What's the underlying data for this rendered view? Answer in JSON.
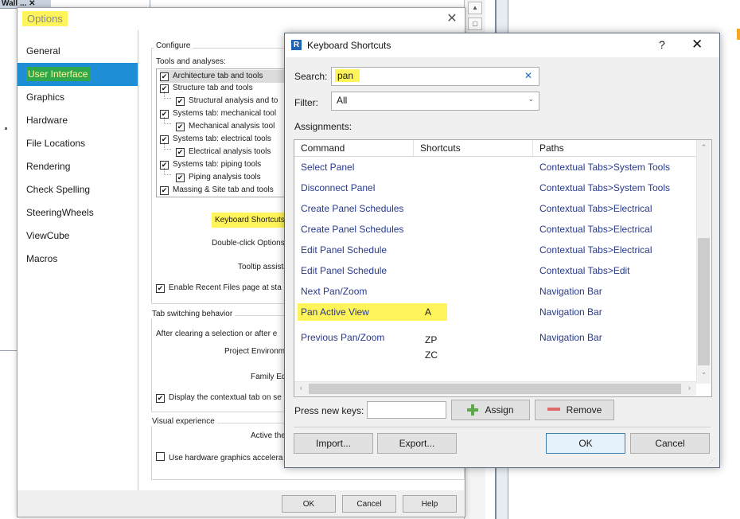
{
  "background": {
    "tab_label": "Wall ... ✕"
  },
  "options_dialog": {
    "title": "Options",
    "nav_items": [
      {
        "label": "General"
      },
      {
        "label": "User Interface"
      },
      {
        "label": "Graphics"
      },
      {
        "label": "Hardware"
      },
      {
        "label": "File Locations"
      },
      {
        "label": "Rendering"
      },
      {
        "label": "Check Spelling"
      },
      {
        "label": "SteeringWheels"
      },
      {
        "label": "ViewCube"
      },
      {
        "label": "Macros"
      }
    ],
    "configure_label": "Configure",
    "tools_label": "Tools and analyses:",
    "tools": [
      {
        "label": "Architecture tab and tools"
      },
      {
        "label": "Structure tab and tools"
      },
      {
        "label": "Structural analysis and to"
      },
      {
        "label": "Systems tab: mechanical tool"
      },
      {
        "label": "Mechanical analysis tool"
      },
      {
        "label": "Systems tab: electrical tools"
      },
      {
        "label": "Electrical analysis tools"
      },
      {
        "label": "Systems tab: piping tools"
      },
      {
        "label": "Piping analysis tools"
      },
      {
        "label": "Massing & Site tab and tools"
      }
    ],
    "keyboard_shortcuts_label": "Keyboard Shortcuts",
    "double_click_label": "Double-click Options",
    "tooltip_label": "Tooltip assistance",
    "recent_files_label": "Enable Recent Files page at sta",
    "tab_switching_label": "Tab switching behavior",
    "after_clearing_label": "After clearing a selection or after e",
    "project_env_label": "Project Environment:",
    "family_editor_label": "Family Editor:",
    "display_contextual_label": "Display the contextual tab on se",
    "visual_experience_label": "Visual experience",
    "active_theme_label": "Active theme:",
    "hw_graphics_label": "Use hardware graphics accelera",
    "ok_label": "OK",
    "cancel_label": "Cancel",
    "help_label": "Help"
  },
  "shortcuts_dialog": {
    "title": "Keyboard Shortcuts",
    "help_glyph": "?",
    "close_glyph": "✕",
    "search_label": "Search:",
    "search_value": "pan",
    "filter_label": "Filter:",
    "filter_value": "All",
    "assignments_label": "Assignments:",
    "columns": [
      "Command",
      "Shortcuts",
      "Paths"
    ],
    "rows": [
      {
        "command": "Select Panel",
        "shortcut": "",
        "path": "Contextual Tabs>System Tools"
      },
      {
        "command": "Disconnect Panel",
        "shortcut": "",
        "path": "Contextual Tabs>System Tools"
      },
      {
        "command": "Create Panel Schedules",
        "shortcut": "",
        "path": "Contextual Tabs>Electrical"
      },
      {
        "command": "Create Panel Schedules",
        "shortcut": "",
        "path": "Contextual Tabs>Electrical"
      },
      {
        "command": "Edit Panel Schedule",
        "shortcut": "",
        "path": "Contextual Tabs>Electrical"
      },
      {
        "command": "Edit Panel Schedule",
        "shortcut": "",
        "path": "Contextual Tabs>Edit"
      },
      {
        "command": "Next Pan/Zoom",
        "shortcut": "",
        "path": "Navigation Bar"
      },
      {
        "command": "Pan Active View",
        "shortcut": "A",
        "path": "Navigation Bar"
      },
      {
        "command": "Previous Pan/Zoom",
        "shortcut": "ZP",
        "shortcut2": "ZC",
        "path": "Navigation Bar"
      }
    ],
    "press_new_keys_label": "Press new keys:",
    "assign_label": "Assign",
    "remove_label": "Remove",
    "import_label": "Import...",
    "export_label": "Export...",
    "ok_label": "OK",
    "cancel_label": "Cancel",
    "highlight_color": "#fff45a",
    "selection_color": "#1e8fd6"
  }
}
